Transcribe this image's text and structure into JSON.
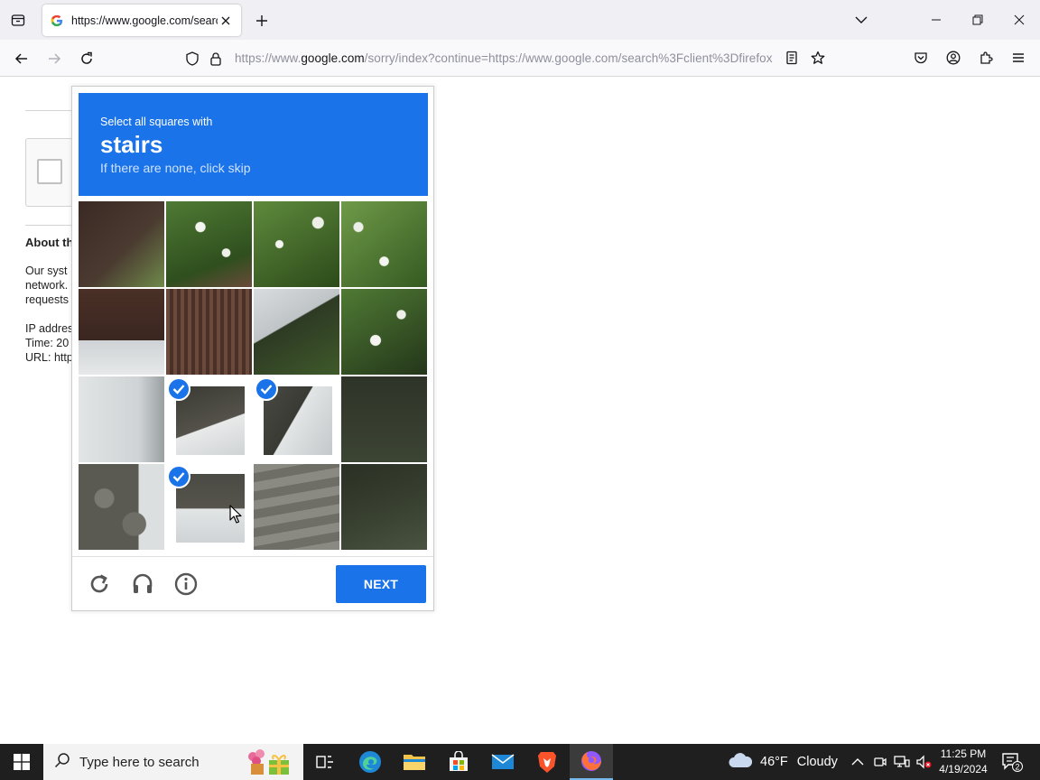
{
  "browser": {
    "tab_title": "https://www.google.com/search",
    "url_prefix": "https://www.",
    "url_host": "google.com",
    "url_rest": "/sorry/index?continue=https://www.google.com/search%3Fclient%3Dfirefox"
  },
  "page": {
    "heading": "About th",
    "para_lines": [
      "Our syst",
      "network.",
      "requests"
    ],
    "info_lines": [
      "IP addres",
      "Time: 20",
      "URL: http"
    ]
  },
  "captcha": {
    "instruction": "Select all squares with",
    "keyword": "stairs",
    "hint": "If there are none, click skip",
    "next_label": "NEXT",
    "selected_tiles": [
      9,
      10,
      13
    ]
  },
  "taskbar": {
    "search_placeholder": "Type here to search",
    "weather_temp": "46°F",
    "weather_desc": "Cloudy",
    "time": "11:25 PM",
    "date": "4/19/2024",
    "notification_count": "2"
  },
  "colors": {
    "captcha_blue": "#1a73e8",
    "taskbar_bg": "#1f1f1f"
  }
}
